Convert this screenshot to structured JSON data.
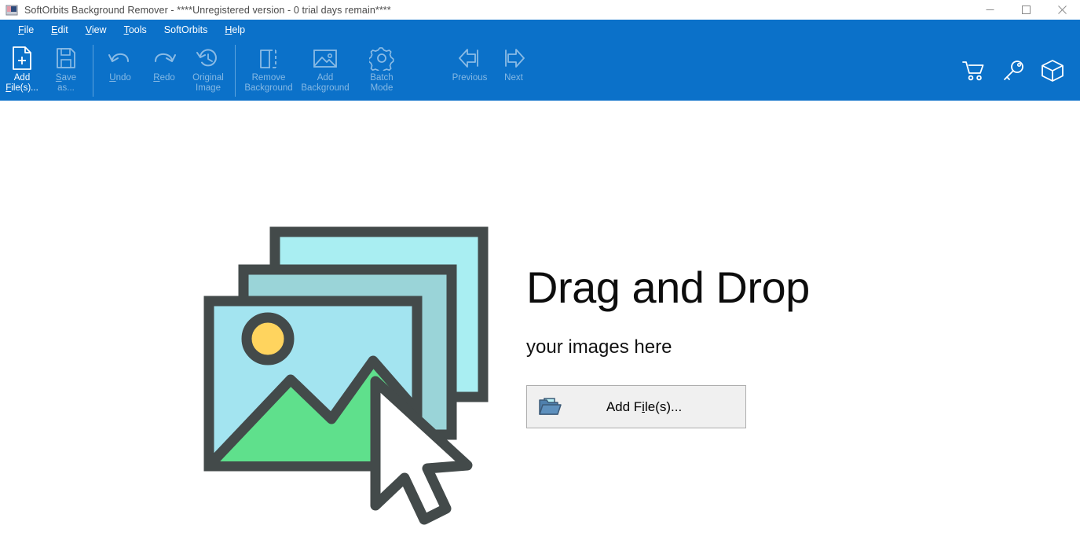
{
  "window": {
    "title": "SoftOrbits Background Remover - ****Unregistered version - 0 trial days remain****",
    "app_icon": "app-image-icon",
    "controls": {
      "minimize": "minimize-icon",
      "maximize": "maximize-icon",
      "close": "close-icon"
    }
  },
  "menubar": {
    "items": [
      {
        "label": "File",
        "accel": "F"
      },
      {
        "label": "Edit",
        "accel": "E"
      },
      {
        "label": "View",
        "accel": "V"
      },
      {
        "label": "Tools",
        "accel": "T"
      },
      {
        "label": "SoftOrbits",
        "accel": ""
      },
      {
        "label": "Help",
        "accel": "H"
      }
    ]
  },
  "toolbar": {
    "background_color": "#0b71c9",
    "buttons": [
      {
        "id": "add-files",
        "line1": "Add",
        "line2": "File(s)...",
        "icon": "document-plus-icon",
        "enabled": true
      },
      {
        "id": "save-as",
        "line1": "Save",
        "line2": "as...",
        "icon": "floppy-disk-icon",
        "enabled": false
      },
      {
        "id": "undo",
        "line1": "Undo",
        "line2": "",
        "icon": "undo-arrow-icon",
        "enabled": false
      },
      {
        "id": "redo",
        "line1": "Redo",
        "line2": "",
        "icon": "redo-arrow-icon",
        "enabled": false
      },
      {
        "id": "original-image",
        "line1": "Original",
        "line2": "Image",
        "icon": "history-clock-icon",
        "enabled": false
      },
      {
        "id": "remove-background",
        "line1": "Remove",
        "line2": "Background",
        "icon": "dashed-square-icon",
        "enabled": false
      },
      {
        "id": "add-background",
        "line1": "Add",
        "line2": "Background",
        "icon": "picture-icon",
        "enabled": false
      },
      {
        "id": "batch-mode",
        "line1": "Batch",
        "line2": "Mode",
        "icon": "gear-icon",
        "enabled": false
      },
      {
        "id": "previous",
        "line1": "Previous",
        "line2": "",
        "icon": "arrow-left-bar-icon",
        "enabled": false
      },
      {
        "id": "next",
        "line1": "Next",
        "line2": "",
        "icon": "arrow-right-bar-icon",
        "enabled": false
      }
    ],
    "right_icons": [
      {
        "id": "cart",
        "icon": "shopping-cart-icon"
      },
      {
        "id": "key",
        "icon": "key-icon"
      },
      {
        "id": "package",
        "icon": "box-package-icon"
      }
    ]
  },
  "main": {
    "illustration": "stacked-photos-cursor-illustration",
    "title": "Drag and Drop",
    "subtitle": "your images here",
    "add_files_button": {
      "label_before": "Add F",
      "label_accel": "i",
      "label_after": "le(s)...",
      "full_label": "Add File(s)...",
      "icon": "open-folder-icon"
    }
  },
  "colors": {
    "accent_blue": "#0b71c9",
    "toolbar_disabled_text": "#86b9e4",
    "button_face": "#f0f0f0",
    "button_border": "#adadad",
    "illustration_outline": "#434a4a",
    "illustration_cyan": "#a9eef2",
    "illustration_teal": "#9ad4d8",
    "illustration_lightblue": "#a3e4f0",
    "illustration_green": "#5fe08c",
    "illustration_sun": "#ffd45e"
  }
}
